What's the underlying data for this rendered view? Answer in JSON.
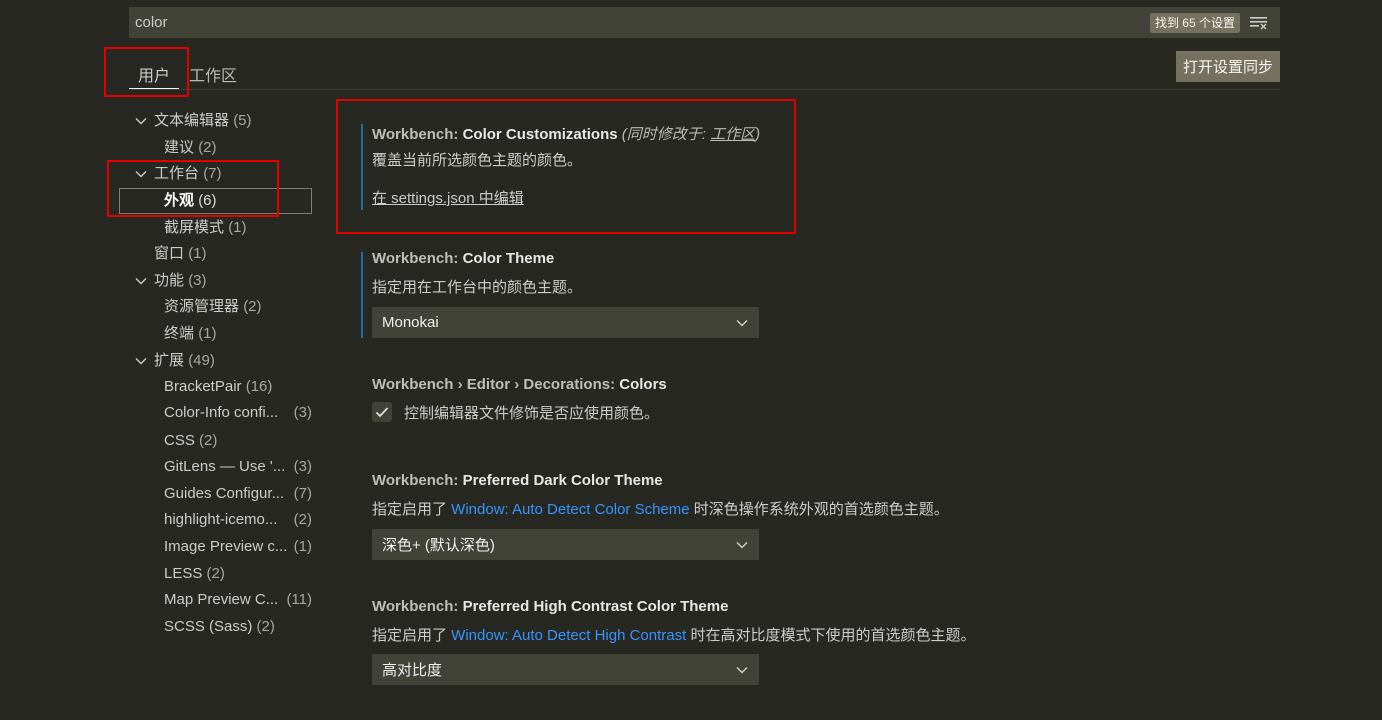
{
  "search": {
    "value": "color",
    "results_badge": "找到 65 个设置",
    "filter_icon": "filter-icon"
  },
  "tabs": {
    "user": "用户",
    "workspace": "工作区"
  },
  "sync_button": "打开设置同步",
  "toc": [
    {
      "label": "文本编辑器",
      "count": "(5)",
      "expanded": true
    },
    {
      "label": "建议",
      "count": "(2)"
    },
    {
      "label": "工作台",
      "count": "(7)",
      "expanded": true
    },
    {
      "label": "外观",
      "count": "(6)",
      "selected": true
    },
    {
      "label": "截屏模式",
      "count": "(1)"
    },
    {
      "label": "窗口",
      "count": "(1)"
    },
    {
      "label": "功能",
      "count": "(3)",
      "expanded": true
    },
    {
      "label": "资源管理器",
      "count": "(2)"
    },
    {
      "label": "终端",
      "count": "(1)"
    },
    {
      "label": "扩展",
      "count": "(49)",
      "expanded": true
    },
    {
      "label": "BracketPair",
      "count": "(16)"
    },
    {
      "label": "Color-Info confi...",
      "count": "(3)"
    },
    {
      "label": "CSS",
      "count": "(2)"
    },
    {
      "label": "GitLens — Use '...",
      "count": "(3)"
    },
    {
      "label": "Guides Configur...",
      "count": "(7)"
    },
    {
      "label": "highlight-icemo...",
      "count": "(2)"
    },
    {
      "label": "Image Preview c...",
      "count": "(1)"
    },
    {
      "label": "LESS",
      "count": "(2)"
    },
    {
      "label": "Map Preview C...",
      "count": "(11)"
    },
    {
      "label": "SCSS (Sass)",
      "count": "(2)"
    }
  ],
  "settings": {
    "color_customizations": {
      "category": "Workbench: ",
      "name": "Color Customizations",
      "also_modified_prefix": "(同时修改于: ",
      "also_modified_link": "工作区",
      "also_modified_suffix": ")",
      "description": "覆盖当前所选颜色主题的颜色。",
      "edit_link": "在 settings.json 中编辑"
    },
    "color_theme": {
      "category": "Workbench: ",
      "name": "Color Theme",
      "description": "指定用在工作台中的颜色主题。",
      "value": "Monokai"
    },
    "decorations_colors": {
      "category": "Workbench › Editor › Decorations: ",
      "name": "Colors",
      "description": "控制编辑器文件修饰是否应使用颜色。",
      "checked": true
    },
    "preferred_dark": {
      "category": "Workbench: ",
      "name": "Preferred Dark Color Theme",
      "desc_prefix": "指定启用了 ",
      "desc_link": "Window: Auto Detect Color Scheme",
      "desc_suffix": " 时深色操作系统外观的首选颜色主题。",
      "value": "深色+ (默认深色)"
    },
    "preferred_hc": {
      "category": "Workbench: ",
      "name": "Preferred High Contrast Color Theme",
      "desc_prefix": "指定启用了 ",
      "desc_link": "Window: Auto Detect High Contrast",
      "desc_suffix": " 时在高对比度模式下使用的首选颜色主题。",
      "value": "高对比度"
    }
  },
  "colors": {
    "background": "#272822",
    "input": "#414339",
    "badge": "#75715e",
    "link": "#3794ff",
    "annotation": "#e50000"
  }
}
